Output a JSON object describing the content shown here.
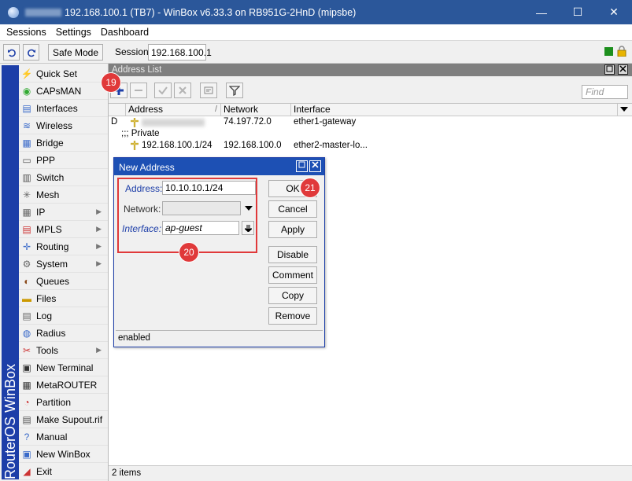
{
  "window": {
    "title": "192.168.100.1 (TB7) - WinBox v6.33.3 on RB951G-2HnD (mipsbe)",
    "controls": {
      "minimize": "—",
      "maximize": "☐",
      "close": "✕"
    }
  },
  "menu": {
    "sessions": "Sessions",
    "settings": "Settings",
    "dashboard": "Dashboard"
  },
  "toolbar": {
    "undo_icon": "undo-icon",
    "redo_icon": "redo-icon",
    "safe_mode": "Safe Mode",
    "session_label": "Session:",
    "session_value": "192.168.100.1",
    "status_color": "#1d8f1d"
  },
  "sidebar": {
    "brand": "RouterOS WinBox",
    "items": [
      {
        "label": "Quick Set",
        "icon": "quick-set-icon",
        "submenu": false
      },
      {
        "label": "CAPsMAN",
        "icon": "capsman-icon",
        "submenu": false
      },
      {
        "label": "Interfaces",
        "icon": "interfaces-icon",
        "submenu": false
      },
      {
        "label": "Wireless",
        "icon": "wireless-icon",
        "submenu": false
      },
      {
        "label": "Bridge",
        "icon": "bridge-icon",
        "submenu": false
      },
      {
        "label": "PPP",
        "icon": "ppp-icon",
        "submenu": false
      },
      {
        "label": "Switch",
        "icon": "switch-icon",
        "submenu": false
      },
      {
        "label": "Mesh",
        "icon": "mesh-icon",
        "submenu": false
      },
      {
        "label": "IP",
        "icon": "ip-icon",
        "submenu": true
      },
      {
        "label": "MPLS",
        "icon": "mpls-icon",
        "submenu": true
      },
      {
        "label": "Routing",
        "icon": "routing-icon",
        "submenu": true
      },
      {
        "label": "System",
        "icon": "system-icon",
        "submenu": true
      },
      {
        "label": "Queues",
        "icon": "queues-icon",
        "submenu": false
      },
      {
        "label": "Files",
        "icon": "files-icon",
        "submenu": false
      },
      {
        "label": "Log",
        "icon": "log-icon",
        "submenu": false
      },
      {
        "label": "Radius",
        "icon": "radius-icon",
        "submenu": false
      },
      {
        "label": "Tools",
        "icon": "tools-icon",
        "submenu": true
      },
      {
        "label": "New Terminal",
        "icon": "terminal-icon",
        "submenu": false
      },
      {
        "label": "MetaROUTER",
        "icon": "metarouter-icon",
        "submenu": false
      },
      {
        "label": "Partition",
        "icon": "partition-icon",
        "submenu": false
      },
      {
        "label": "Make Supout.rif",
        "icon": "supout-icon",
        "submenu": false
      },
      {
        "label": "Manual",
        "icon": "manual-icon",
        "submenu": false
      },
      {
        "label": "New WinBox",
        "icon": "new-winbox-icon",
        "submenu": false
      },
      {
        "label": "Exit",
        "icon": "exit-icon",
        "submenu": false
      }
    ]
  },
  "address_list": {
    "title": "Address List",
    "find_placeholder": "Find",
    "columns": [
      "Address",
      "Network",
      "Interface"
    ],
    "rows": [
      {
        "flag": "D",
        "address": "",
        "network": "74.197.72.0",
        "interface": "ether1-gateway"
      },
      {
        "comment": ";;; Private"
      },
      {
        "flag": "",
        "address": "192.168.100.1/24",
        "network": "192.168.100.0",
        "interface": "ether2-master-lo..."
      }
    ],
    "status": "2 items"
  },
  "dialog": {
    "title": "New Address",
    "address_label": "Address:",
    "address_value": "10.10.10.1/24",
    "network_label": "Network:",
    "network_value": "",
    "interface_label": "Interface:",
    "interface_value": "ap-guest",
    "buttons": {
      "ok": "OK",
      "cancel": "Cancel",
      "apply": "Apply",
      "disable": "Disable",
      "comment": "Comment",
      "copy": "Copy",
      "remove": "Remove"
    },
    "status": "enabled"
  },
  "markers": {
    "add": "19",
    "fields": "20",
    "ok": "21"
  },
  "colors": {
    "accent": "#1d3ea8",
    "marker": "#e0393a",
    "titlebar": "#2b579a"
  }
}
